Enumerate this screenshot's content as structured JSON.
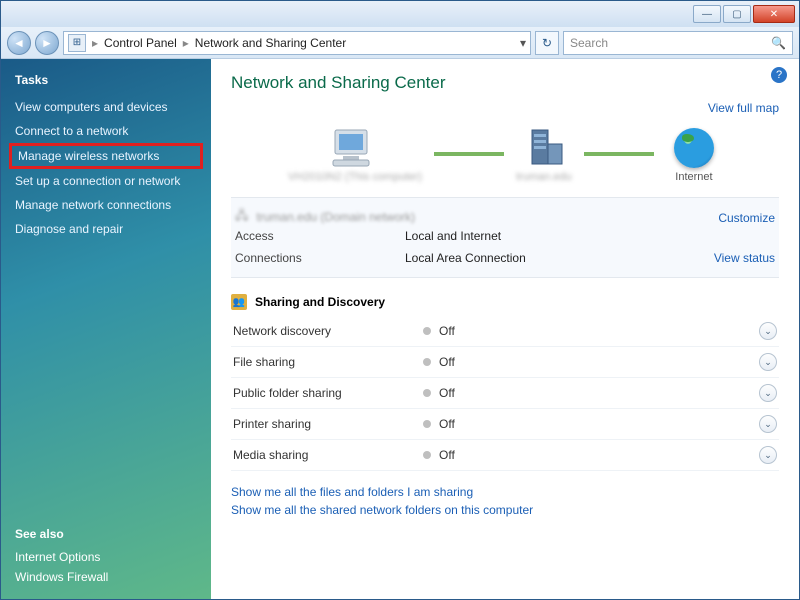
{
  "titlebar": {
    "min": "—",
    "max": "▢",
    "close": "✕"
  },
  "address": {
    "crumb1": "Control Panel",
    "crumb2": "Network and Sharing Center"
  },
  "search": {
    "placeholder": "Search"
  },
  "sidebar": {
    "tasks_heading": "Tasks",
    "tasks": [
      "View computers and devices",
      "Connect to a network",
      "Manage wireless networks",
      "Set up a connection or network",
      "Manage network connections",
      "Diagnose and repair"
    ],
    "seealso_heading": "See also",
    "seealso": [
      "Internet Options",
      "Windows Firewall"
    ]
  },
  "page": {
    "title": "Network and Sharing Center",
    "view_full_map": "View full map",
    "map": {
      "node1": "VH2010N2 (This computer)",
      "node2": "truman.edu",
      "node3": "Internet"
    },
    "network_header": "truman.edu (Domain network)",
    "customize": "Customize",
    "access_label": "Access",
    "access_value": "Local and Internet",
    "connections_label": "Connections",
    "connections_value": "Local Area Connection",
    "view_status": "View status",
    "sharing_heading": "Sharing and Discovery",
    "sharing_rows": [
      {
        "label": "Network discovery",
        "value": "Off"
      },
      {
        "label": "File sharing",
        "value": "Off"
      },
      {
        "label": "Public folder sharing",
        "value": "Off"
      },
      {
        "label": "Printer sharing",
        "value": "Off"
      },
      {
        "label": "Media sharing",
        "value": "Off"
      }
    ],
    "footer_links": [
      "Show me all the files and folders I am sharing",
      "Show me all the shared network folders on this computer"
    ]
  }
}
